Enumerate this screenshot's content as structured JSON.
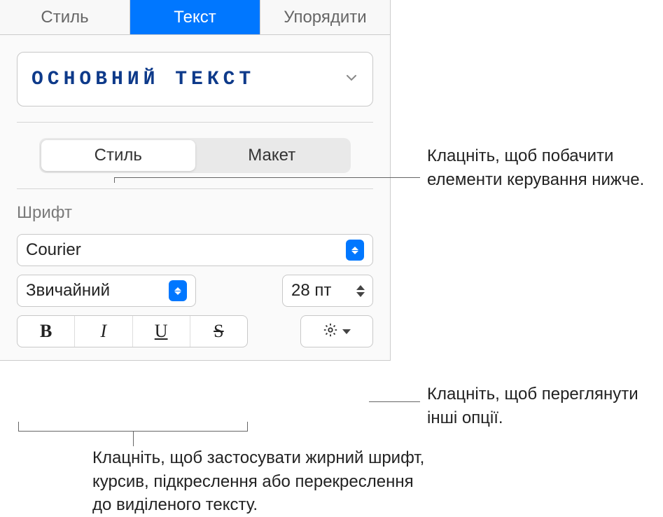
{
  "tabs": {
    "style": "Стиль",
    "text": "Текст",
    "arrange": "Упорядити"
  },
  "paragraph_style": {
    "label": "ОСНОВНИЙ ТЕКСТ"
  },
  "segmented": {
    "style": "Стиль",
    "layout": "Макет"
  },
  "font": {
    "section_label": "Шрифт",
    "family": "Courier",
    "weight": "Звичайний",
    "size": "28 пт",
    "bold": "B",
    "italic": "I",
    "underline": "U",
    "strike": "S"
  },
  "callouts": {
    "seg_hint": "Клацніть, щоб побачити елементи керування нижче.",
    "adv_hint": "Клацніть, щоб переглянути інші опції.",
    "bius_hint": "Клацніть, щоб застосувати жирний шрифт, курсив, підкреслення або перекреслення до виділеного тексту."
  }
}
